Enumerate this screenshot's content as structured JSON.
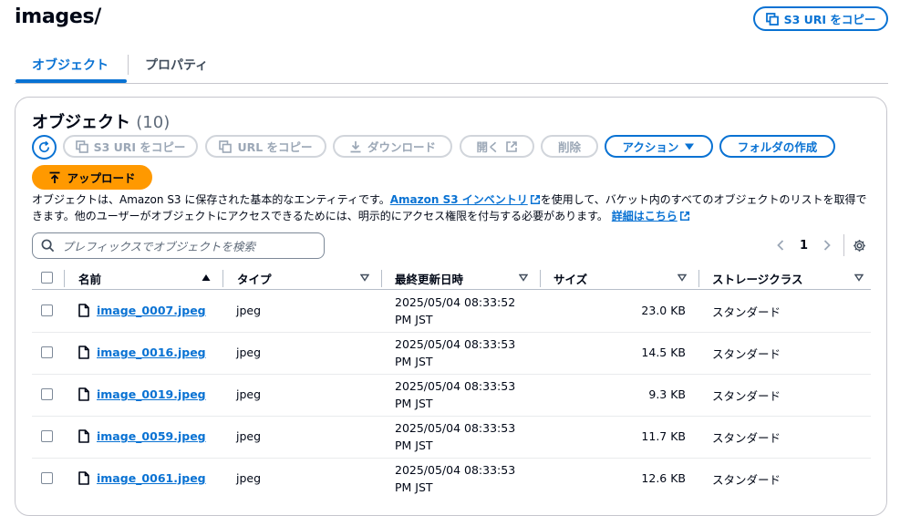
{
  "header": {
    "title": "images/",
    "copy_s3_uri_label": "S3 URI をコピー"
  },
  "tabs": [
    {
      "label": "オブジェクト",
      "active": true
    },
    {
      "label": "プロパティ",
      "active": false
    }
  ],
  "objects_panel": {
    "title": "オブジェクト",
    "count": "(10)",
    "toolbar": {
      "copy_s3_uri": "S3 URI をコピー",
      "copy_url": "URL をコピー",
      "download": "ダウンロード",
      "open": "開く",
      "delete": "削除",
      "actions": "アクション",
      "create_folder": "フォルダの作成",
      "upload": "アップロード"
    },
    "description": {
      "part1": "オブジェクトは、Amazon S3 に保存された基本的なエンティティです。",
      "inventory_link": "Amazon S3 インベントリ",
      "part2": "を使用して、バケット内のすべてのオブジェクトのリストを取得できます。他のユーザーがオブジェクトにアクセスできるためには、明示的にアクセス権限を付与する必要があります。",
      "learn_more_link": "詳細はこちら"
    },
    "search": {
      "placeholder": "プレフィックスでオブジェクトを検索"
    },
    "pagination": {
      "current_page": "1"
    },
    "columns": [
      "名前",
      "タイプ",
      "最終更新日時",
      "サイズ",
      "ストレージクラス"
    ],
    "rows": [
      {
        "name": "image_0007.jpeg",
        "type": "jpeg",
        "modified_1": "2025/05/04 08:33:52",
        "modified_2": "PM JST",
        "size": "23.0 KB",
        "storage": "スタンダード"
      },
      {
        "name": "image_0016.jpeg",
        "type": "jpeg",
        "modified_1": "2025/05/04 08:33:53",
        "modified_2": "PM JST",
        "size": "14.5 KB",
        "storage": "スタンダード"
      },
      {
        "name": "image_0019.jpeg",
        "type": "jpeg",
        "modified_1": "2025/05/04 08:33:53",
        "modified_2": "PM JST",
        "size": "9.3 KB",
        "storage": "スタンダード"
      },
      {
        "name": "image_0059.jpeg",
        "type": "jpeg",
        "modified_1": "2025/05/04 08:33:53",
        "modified_2": "PM JST",
        "size": "11.7 KB",
        "storage": "スタンダード"
      },
      {
        "name": "image_0061.jpeg",
        "type": "jpeg",
        "modified_1": "2025/05/04 08:33:53",
        "modified_2": "PM JST",
        "size": "12.6 KB",
        "storage": "スタンダード"
      }
    ]
  },
  "colors": {
    "accent": "#0972d3",
    "upload": "#ff9900",
    "disabled": "#9ba7b6",
    "text": "#000716"
  }
}
